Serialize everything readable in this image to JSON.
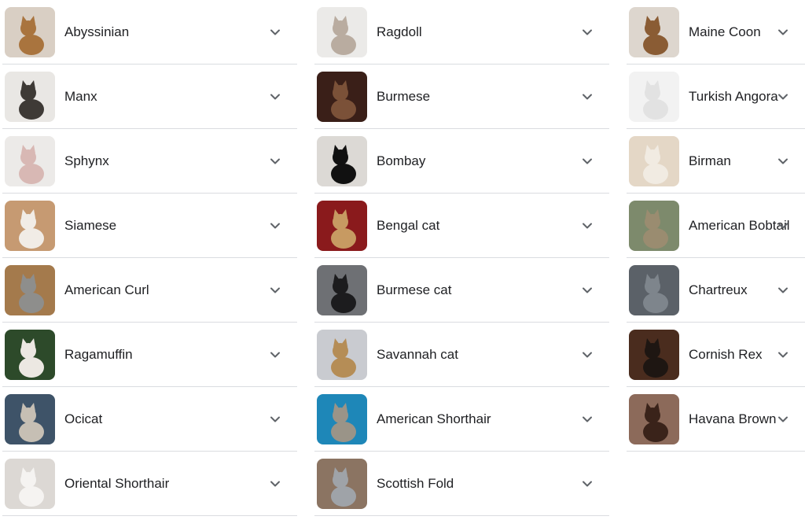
{
  "columns": [
    [
      {
        "label": "Abyssinian",
        "icon": "cat-photo",
        "bg": "#d9cfc4",
        "fg": "#a9743e"
      },
      {
        "label": "Manx",
        "icon": "cat-photo",
        "bg": "#e9e7e4",
        "fg": "#3e3a36"
      },
      {
        "label": "Sphynx",
        "icon": "cat-photo",
        "bg": "#eceae8",
        "fg": "#d8b8b4"
      },
      {
        "label": "Siamese",
        "icon": "cat-photo",
        "bg": "#c69a72",
        "fg": "#f1ece6"
      },
      {
        "label": "American Curl",
        "icon": "cat-photo",
        "bg": "#a47a4c",
        "fg": "#8e8e8c"
      },
      {
        "label": "Ragamuffin",
        "icon": "cat-photo",
        "bg": "#2d4a2a",
        "fg": "#ece8e2"
      },
      {
        "label": "Ocicat",
        "icon": "cat-photo",
        "bg": "#3e5368",
        "fg": "#c6bfb4"
      },
      {
        "label": "Oriental Shorthair",
        "icon": "cat-photo",
        "bg": "#dcd8d4",
        "fg": "#f5f3f1"
      }
    ],
    [
      {
        "label": "Ragdoll",
        "icon": "cat-photo",
        "bg": "#ebeae8",
        "fg": "#b9aca0"
      },
      {
        "label": "Burmese",
        "icon": "cat-photo",
        "bg": "#3a1f18",
        "fg": "#7b5138"
      },
      {
        "label": "Bombay",
        "icon": "cat-photo",
        "bg": "#dcd9d5",
        "fg": "#111111"
      },
      {
        "label": "Bengal cat",
        "icon": "cat-photo",
        "bg": "#8a1a1c",
        "fg": "#c79a62"
      },
      {
        "label": "Burmese cat",
        "icon": "cat-photo",
        "bg": "#6e7074",
        "fg": "#1c1c1e"
      },
      {
        "label": "Savannah cat",
        "icon": "cat-photo",
        "bg": "#c9cbd0",
        "fg": "#b58d56"
      },
      {
        "label": "American Shorthair",
        "icon": "cat-photo",
        "bg": "#1e87b8",
        "fg": "#9a9488"
      },
      {
        "label": "Scottish Fold",
        "icon": "cat-photo",
        "bg": "#8b7462",
        "fg": "#9fa3a8"
      }
    ],
    [
      {
        "label": "Maine Coon",
        "icon": "cat-photo",
        "bg": "#ddd6ce",
        "fg": "#8a5c34"
      },
      {
        "label": "Turkish Angora",
        "icon": "cat-photo",
        "bg": "#f2f2f2",
        "fg": "#e2e2e2"
      },
      {
        "label": "Birman",
        "icon": "cat-photo",
        "bg": "#e4d7c6",
        "fg": "#f1ebe2"
      },
      {
        "label": "American Bobtail",
        "icon": "cat-photo",
        "bg": "#7d8a6c",
        "fg": "#9a8c70"
      },
      {
        "label": "Chartreux",
        "icon": "cat-photo",
        "bg": "#5b6168",
        "fg": "#7e858c"
      },
      {
        "label": "Cornish Rex",
        "icon": "cat-photo",
        "bg": "#4a2c1e",
        "fg": "#1e1612"
      },
      {
        "label": "Havana Brown",
        "icon": "cat-photo",
        "bg": "#8c6a5a",
        "fg": "#3a231a"
      }
    ]
  ],
  "chevron_icon": "chevron-down-icon"
}
